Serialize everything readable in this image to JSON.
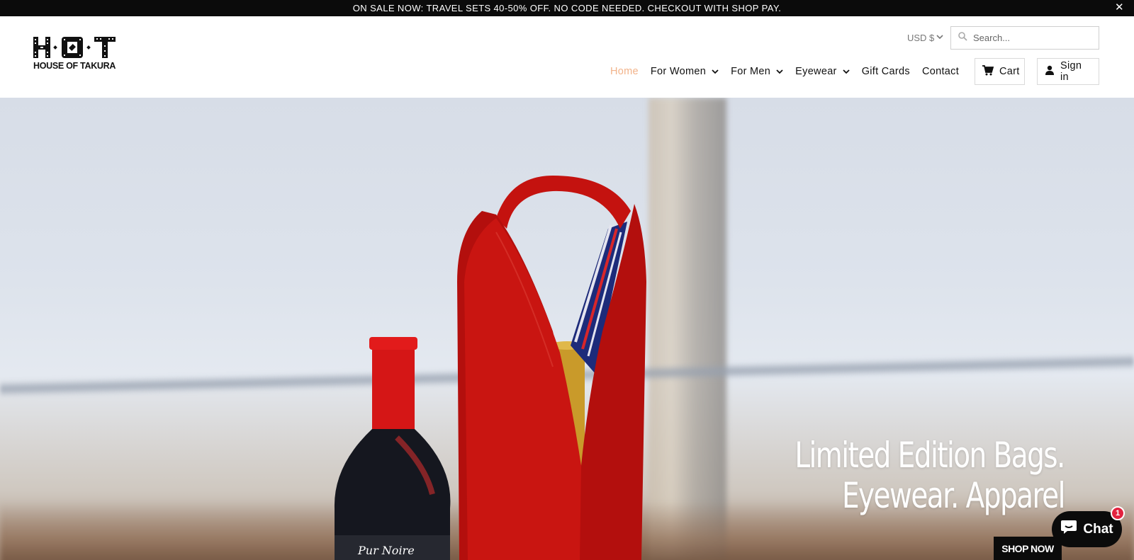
{
  "announcement": {
    "text": "ON SALE NOW: TRAVEL SETS 40-50% OFF. NO CODE NEEDED. CHECKOUT WITH SHOP PAY.",
    "close": "✕"
  },
  "brand": {
    "logo_letters": "H·O·T",
    "name": "HOUSE OF TAKURA"
  },
  "currency": {
    "selected": "USD $"
  },
  "search": {
    "placeholder": "Search..."
  },
  "nav": {
    "items": [
      {
        "label": "Home",
        "active": true,
        "dropdown": false
      },
      {
        "label": "For Women",
        "active": false,
        "dropdown": true
      },
      {
        "label": "For Men",
        "active": false,
        "dropdown": true
      },
      {
        "label": "Eyewear",
        "active": false,
        "dropdown": true
      },
      {
        "label": "Gift Cards",
        "active": false,
        "dropdown": false
      },
      {
        "label": "Contact",
        "active": false,
        "dropdown": false
      }
    ]
  },
  "header_actions": {
    "cart_label": "Cart",
    "signin_label": "Sign in"
  },
  "hero": {
    "headline_line1": "Limited Edition Bags.",
    "headline_line2": "Eyewear. Apparel",
    "cta": "SHOP NOW",
    "bottle_label": "Pur Noire"
  },
  "chat": {
    "label": "Chat",
    "badge": "1"
  },
  "colors": {
    "announcement_bg": "#0b0b0b",
    "active_nav": "#f2b38a",
    "bag_red": "#c4120f",
    "chat_badge": "#e2223e"
  }
}
